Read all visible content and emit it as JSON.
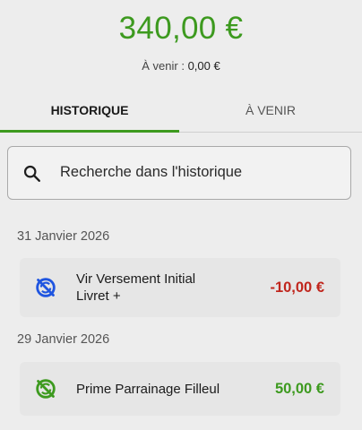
{
  "account": {
    "balance": "340,00 €",
    "pending_label": "À venir : ",
    "pending_amount": "0,00 €"
  },
  "tabs": {
    "history": "HISTORIQUE",
    "upcoming": "À VENIR",
    "active": "history"
  },
  "search": {
    "placeholder": "Recherche dans l'historique"
  },
  "colors": {
    "positive": "#3d9a1f",
    "negative": "#c0261d",
    "debit_icon": "#1f55e0"
  },
  "transactions": [
    {
      "date": "31 Janvier 2026",
      "label_line1": "Vir Versement Initial",
      "label_line2": "Livret +",
      "amount": "-10,00 €",
      "type": "debit",
      "icon": "no-sync-icon"
    },
    {
      "date": "29 Janvier 2026",
      "label_line1": "Prime Parrainage Filleul",
      "amount": "50,00 €",
      "type": "credit",
      "icon": "no-sync-icon"
    }
  ]
}
